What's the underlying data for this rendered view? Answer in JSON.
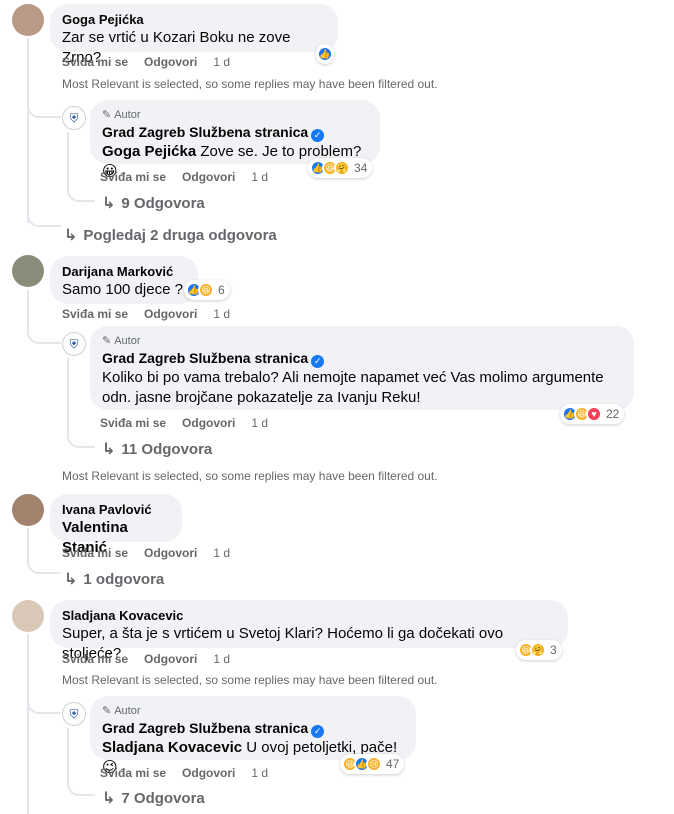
{
  "actions": {
    "like": "Sviđa mi se",
    "reply": "Odgovori",
    "time": "1 d"
  },
  "filtered_notice": "Most Relevant is selected, so some replies may have been filtered out.",
  "author_tag": "Autor",
  "page_name": "Grad Zagreb Službena stranica",
  "threads": [
    {
      "author": "Goga Pejićka",
      "text": "Zar se vrtić u Kozari Boku ne zove Zrno?",
      "reply": {
        "mention": "Goga Pejićka",
        "text": " Zove se. Je to problem? 😀",
        "reaction_count": "34",
        "replies": "9 Odgovora"
      },
      "more": "Pogledaj 2 druga odgovora"
    },
    {
      "author": "Darijana Marković",
      "text": "Samo 100 djece ?",
      "reaction_count": "6",
      "reply": {
        "text_line1": "Koliko bi po vama trebalo? Ali nemojte napamet već Vas molimo argumente",
        "text_line2": "odn. jasne brojčane pokazatelje za Ivanju Reku!",
        "reaction_count": "22",
        "replies": "11 Odgovora"
      }
    },
    {
      "author": "Ivana Pavlović",
      "text": "Valentina Stanić",
      "replies": "1 odgovora"
    },
    {
      "author": "Sladjana Kovacevic",
      "text": "Super, a šta je s vrtićem u Svetoj Klari? Hoćemo li ga dočekati ovo stoljeće?",
      "reaction_count": "3",
      "reply": {
        "mention": "Sladjana Kovacevic",
        "text": " U ovoj petoljetki, pače! 😉",
        "reaction_count": "47",
        "replies": "7 Odgovora"
      }
    }
  ],
  "colors": {
    "bubble": "#f0f2f5",
    "secondary_text": "#65676b",
    "blue": "#1877f2"
  }
}
